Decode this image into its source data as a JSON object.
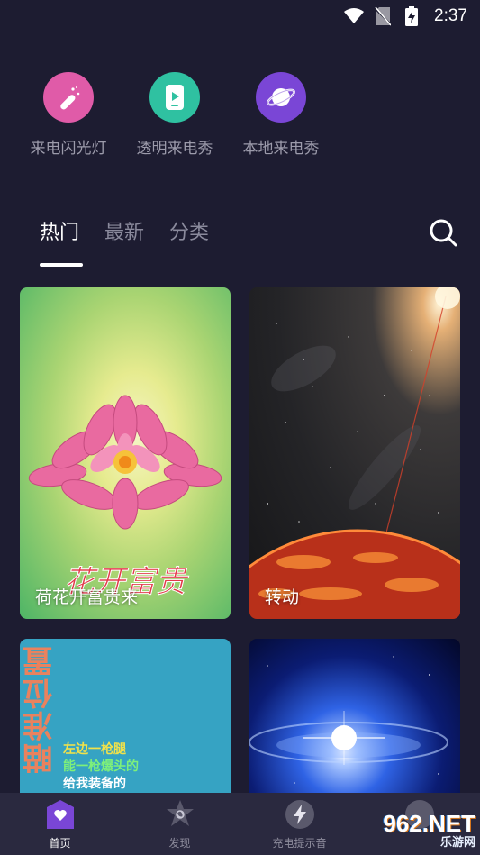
{
  "status_bar": {
    "time": "2:37"
  },
  "features": [
    {
      "label": "来电闪光灯",
      "color": "#e05ba8",
      "icon": "magic-wand-icon"
    },
    {
      "label": "透明来电秀",
      "color": "#2fc1a1",
      "icon": "phone-play-icon"
    },
    {
      "label": "本地来电秀",
      "color": "#7a46d6",
      "icon": "planet-icon"
    }
  ],
  "tabs": [
    {
      "label": "热门",
      "active": true
    },
    {
      "label": "最新",
      "active": false
    },
    {
      "label": "分类",
      "active": false
    }
  ],
  "cards": [
    {
      "title": "荷花开富贵来",
      "art_text": "花开富贵"
    },
    {
      "title": "转动"
    },
    {
      "title": "",
      "art_text_vertical": "瞄准位置",
      "art_lines": [
        "左边一枪腿",
        "能一枪爆头的",
        "给我装备的"
      ]
    },
    {
      "title": ""
    }
  ],
  "bottom_nav": [
    {
      "label": "首页",
      "icon": "home-heart-icon",
      "active": true
    },
    {
      "label": "发现",
      "icon": "discover-icon",
      "active": false
    },
    {
      "label": "充电提示音",
      "icon": "charging-icon",
      "active": false
    },
    {
      "label": "",
      "icon": "profile-icon",
      "active": false
    }
  ],
  "watermark": {
    "big": "962.NET",
    "small": "乐游网"
  }
}
